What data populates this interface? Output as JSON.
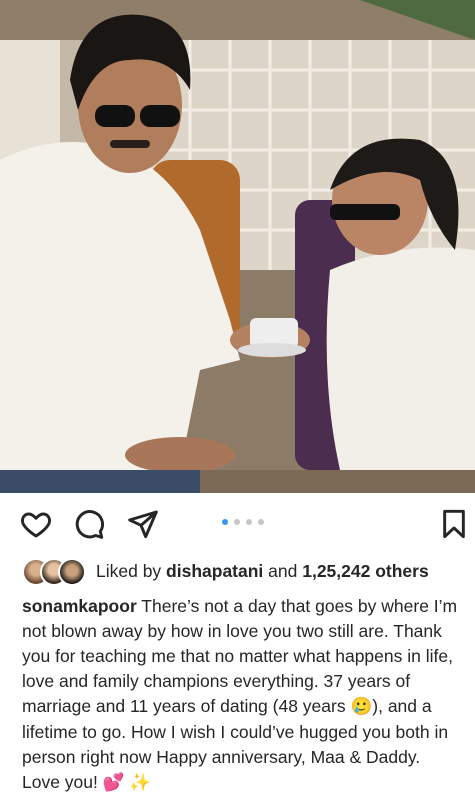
{
  "post": {
    "image_alt": "Vintage photo of a man in sunglasses and white shirt with a woman in sunglasses holding a cup",
    "carousel": {
      "count": 4,
      "active": 0
    }
  },
  "actions": {
    "like_icon": "heart-icon",
    "comment_icon": "comment-icon",
    "share_icon": "send-icon",
    "save_icon": "bookmark-icon"
  },
  "likes": {
    "prefix": "Liked by ",
    "user": "dishapatani",
    "middle": " and ",
    "count": "1,25,242 others"
  },
  "caption": {
    "username": "sonamkapoor",
    "text_part1": " There’s not a day that goes by where I’m not blown away by how in love you two still are. Thank you for teaching me that no matter what happens in life, love and family  champions everything. 37 years of marriage and 11 years of dating (48 years ",
    "emoji1": "🥲",
    "text_part2": "), and a lifetime to go. How I wish I could’ve hugged you both in person right now Happy anniversary, Maa & Daddy. Love you! ",
    "emoji2": "💕",
    "emoji3": "✨"
  },
  "colors": {
    "accent_dot": "#3897f0",
    "inactive_dot": "#c7c7c7",
    "text": "#262626"
  }
}
